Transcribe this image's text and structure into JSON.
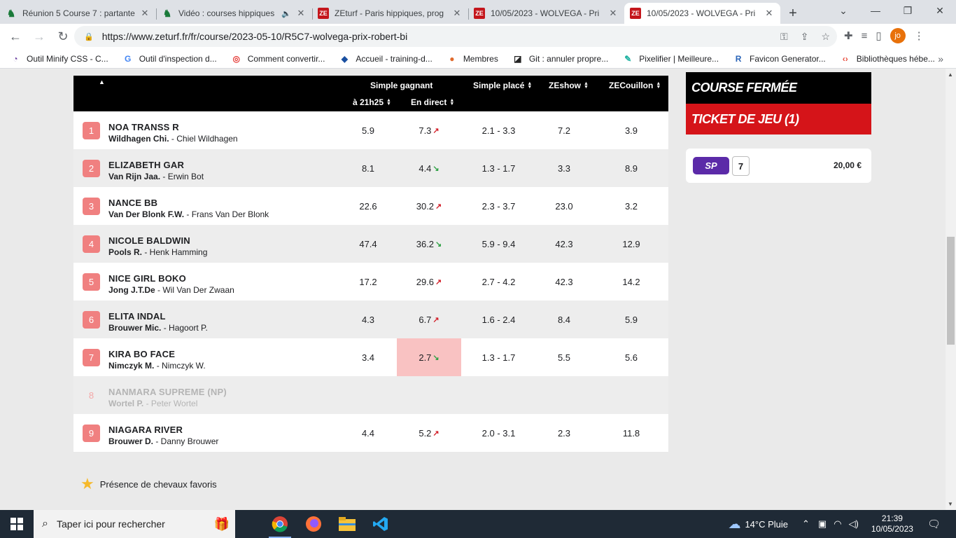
{
  "browser": {
    "tabs": [
      {
        "title": "Réunion 5 Course 7 : partante",
        "favicon": "horse-icon",
        "active": false
      },
      {
        "title": "Vidéo : courses hippiques",
        "favicon": "horse-icon",
        "audio": true,
        "active": false
      },
      {
        "title": "ZEturf - Paris hippiques, prog",
        "favicon": "zeturf-icon",
        "active": false
      },
      {
        "title": "10/05/2023 - WOLVEGA - Pri",
        "favicon": "zeturf-icon",
        "active": false
      },
      {
        "title": "10/05/2023 - WOLVEGA - Pri",
        "favicon": "zeturf-icon",
        "active": true
      }
    ],
    "url": "https://www.zeturf.fr/fr/course/2023-05-10/R5C7-wolvega-prix-robert-bi",
    "profile_initials": "jo",
    "bookmarks": [
      {
        "label": "Outil Minify CSS - C...",
        "icon": "minify-icon",
        "color": "#6b3fa0"
      },
      {
        "label": "Outil d'inspection d...",
        "icon": "google-icon",
        "color": "#4285f4"
      },
      {
        "label": "Comment convertir...",
        "icon": "circle-icon",
        "color": "#e53935"
      },
      {
        "label": "Accueil - training-d...",
        "icon": "diamond-icon",
        "color": "#1a4fa0"
      },
      {
        "label": "Membres",
        "icon": "member-icon",
        "color": "#e06a2c"
      },
      {
        "label": "Git : annuler propre...",
        "icon": "git-icon",
        "color": "#222222"
      },
      {
        "label": "Pixelifier | Meilleure...",
        "icon": "feather-icon",
        "color": "#1bb0a0"
      },
      {
        "label": "Favicon Generator...",
        "icon": "r-icon",
        "color": "#2a64b8"
      },
      {
        "label": "Bibliothèques hébe...",
        "icon": "code-icon",
        "color": "#e84c3d"
      }
    ]
  },
  "table": {
    "headers": {
      "simple_gagnant": "Simple gagnant",
      "a_21h25": "à 21h25",
      "en_direct": "En direct",
      "simple_place": "Simple placé",
      "zeshow": "ZEshow",
      "zecouillon": "ZECouillon"
    },
    "rows": [
      {
        "num": "1",
        "horse": "NOA TRANSS R",
        "jockey": "Wildhagen Chi.",
        "trainer": " - Chiel Wildhagen",
        "odds_21h25": "5.9",
        "live": "7.3",
        "trend": "up",
        "place": "2.1 - 3.3",
        "zeshow": "7.2",
        "zecouillon": "3.9"
      },
      {
        "num": "2",
        "horse": "ELIZABETH GAR",
        "jockey": "Van Rijn Jaa.",
        "trainer": " - Erwin Bot",
        "odds_21h25": "8.1",
        "live": "4.4",
        "trend": "down",
        "place": "1.3 - 1.7",
        "zeshow": "3.3",
        "zecouillon": "8.9"
      },
      {
        "num": "3",
        "horse": "NANCE BB",
        "jockey": "Van Der Blonk F.W.",
        "trainer": " - Frans Van Der Blonk",
        "odds_21h25": "22.6",
        "live": "30.2",
        "trend": "up",
        "place": "2.3 - 3.7",
        "zeshow": "23.0",
        "zecouillon": "3.2"
      },
      {
        "num": "4",
        "horse": "NICOLE BALDWIN",
        "jockey": "Pools R.",
        "trainer": " - Henk Hamming",
        "odds_21h25": "47.4",
        "live": "36.2",
        "trend": "down",
        "place": "5.9 - 9.4",
        "zeshow": "42.3",
        "zecouillon": "12.9"
      },
      {
        "num": "5",
        "horse": "NICE GIRL BOKO",
        "jockey": "Jong J.T.De",
        "trainer": " - Wil Van Der Zwaan",
        "odds_21h25": "17.2",
        "live": "29.6",
        "trend": "up",
        "place": "2.7 - 4.2",
        "zeshow": "42.3",
        "zecouillon": "14.2"
      },
      {
        "num": "6",
        "horse": "ELITA INDAL",
        "jockey": "Brouwer Mic.",
        "trainer": " - Hagoort P.",
        "odds_21h25": "4.3",
        "live": "6.7",
        "trend": "up",
        "place": "1.6 - 2.4",
        "zeshow": "8.4",
        "zecouillon": "5.9"
      },
      {
        "num": "7",
        "horse": "KIRA BO FACE",
        "jockey": "Nimczyk M.",
        "trainer": " - Nimczyk W.",
        "odds_21h25": "3.4",
        "live": "2.7",
        "trend": "down",
        "place": "1.3 - 1.7",
        "zeshow": "5.5",
        "zecouillon": "5.6",
        "selected": true
      },
      {
        "num": "8",
        "horse": "NANMARA SUPREME (NP)",
        "jockey": "Wortel P.",
        "trainer": " - Peter Wortel",
        "odds_21h25": "",
        "live": "",
        "trend": "",
        "place": "",
        "zeshow": "",
        "zecouillon": "",
        "scratched": true
      },
      {
        "num": "9",
        "horse": "NIAGARA RIVER",
        "jockey": "Brouwer D.",
        "trainer": " - Danny Brouwer",
        "odds_21h25": "4.4",
        "live": "5.2",
        "trend": "up",
        "place": "2.0 - 3.1",
        "zeshow": "2.3",
        "zecouillon": "11.8"
      }
    ]
  },
  "legend_text": "Présence de chevaux favoris",
  "sidebar": {
    "closed_label": "COURSE FERMÉE",
    "ticket_label": "TICKET DE JEU (1)",
    "bet_type": "SP",
    "bet_pick": "7",
    "bet_amount": "20,00 €"
  },
  "taskbar": {
    "search_placeholder": "Taper ici pour rechercher",
    "weather": "14°C  Pluie",
    "time": "21:39",
    "date": "10/05/2023"
  }
}
